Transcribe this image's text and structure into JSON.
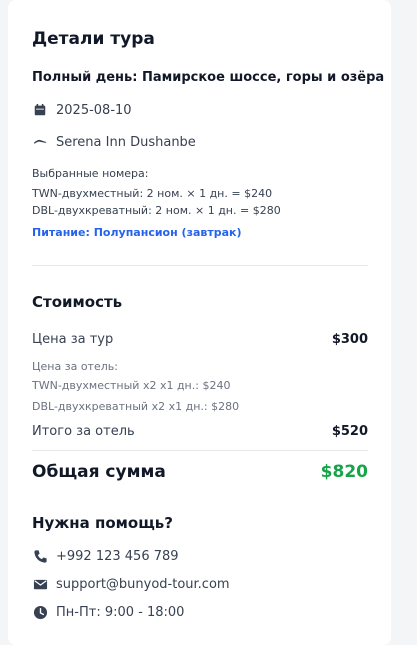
{
  "details": {
    "title": "Детали тура",
    "tour_name": "Полный день: Памирское шоссе, горы и озёра",
    "date": "2025-08-10",
    "hotel": "Serena Inn Dushanbe",
    "rooms_label": "Выбранные номера:",
    "rooms": [
      "TWN-двухместный: 2 ном. × 1 дн. = $240",
      "DBL-двухкреватный: 2 ном. × 1 дн. = $280"
    ],
    "meal": "Питание: Полупансион (завтрак)"
  },
  "cost": {
    "title": "Стоимость",
    "tour_price_label": "Цена за тур",
    "tour_price_value": "$300",
    "hotel_price_label": "Цена за отель:",
    "hotel_lines": [
      "TWN-двухместный x2 x1 дн.: $240",
      "DBL-двухкреватный x2 x1 дн.: $280"
    ],
    "hotel_total_label": "Итого за отель",
    "hotel_total_value": "$520",
    "grand_total_label": "Общая сумма",
    "grand_total_value": "$820"
  },
  "help": {
    "title": "Нужна помощь?",
    "phone": "+992 123 456 789",
    "email": "support@bunyod-tour.com",
    "hours": "Пн-Пт: 9:00 - 18:00"
  },
  "icons": {
    "date": "calendar-icon",
    "hotel": "bed-icon",
    "phone": "phone-icon",
    "email": "mail-icon",
    "hours": "clock-icon"
  },
  "colors": {
    "accent_blue": "#2563eb",
    "total_green": "#16a34a"
  }
}
